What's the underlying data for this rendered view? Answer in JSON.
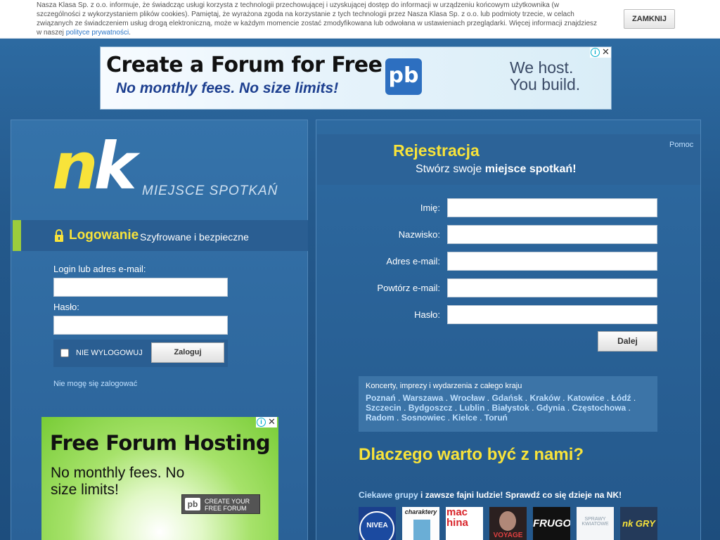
{
  "cookie": {
    "text": "Nasza Klasa Sp. z o.o. informuje, że świadcząc usługi korzysta z technologii przechowującej i uzyskującej dostęp do informacji w urządzeniu końcowym użytkownika (w szczególności z wykorzystaniem plików cookies). Pamiętaj, że wyrażona zgoda na korzystanie z tych technologii przez Nasza Klasa Sp. z o.o. lub podmioty trzecie, w celach związanych ze świadczeniem usług drogą elektroniczną, może w każdym momencie zostać zmodyfikowana lub odwołana w ustawieniach przeglądarki. Więcej informacji znajdziesz w naszej",
    "link": "polityce prywatności",
    "close_label": "ZAMKNIJ"
  },
  "top_ad": {
    "line1": "Create a Forum for Free",
    "line2": "No monthly fees. No size limits!",
    "logo": "pb",
    "right1": "We host.",
    "right2": "You build."
  },
  "left": {
    "logo_n": "n",
    "logo_k": "k",
    "tagline": "MIEJSCE SPOTKAŃ",
    "login_title": "Logowanie",
    "login_sub": "Szyfrowane i bezpieczne",
    "login_label": "Login lub adres e-mail:",
    "password_label": "Hasło:",
    "remember_label": "NIE WYLOGOWUJ",
    "login_button": "Zaloguj",
    "forgot_link": "Nie mogę się zalogować"
  },
  "side_ad": {
    "line1": "Free Forum Hosting",
    "line2": "No monthly fees. No size limits!",
    "cta_logo": "pb",
    "cta": "CREATE YOUR FREE FORUM"
  },
  "right": {
    "title": "Rejestracja",
    "sub_prefix": "Stwórz swoje",
    "sub_bold": "miejsce spotkań!",
    "help": "Pomoc",
    "labels": [
      "Imię:",
      "Nazwisko:",
      "Adres e-mail:",
      "Powtórz e-mail:",
      "Hasło:"
    ],
    "next_button": "Dalej",
    "cities_title": "Koncerty, imprezy i wydarzenia z całego kraju",
    "cities": [
      "Poznań",
      "Warszawa",
      "Wrocław",
      "Gdańsk",
      "Kraków",
      "Katowice",
      "Łódź",
      "Szczecin",
      "Bydgoszcz",
      "Lublin",
      "Białystok",
      "Gdynia",
      "Częstochowa",
      "Radom",
      "Sosnowiec",
      "Kielce",
      "Toruń"
    ],
    "why_title": "Dlaczego warto być z nami?",
    "groups_link": "Ciekawe grupy",
    "groups_rest": " i zawsze fajni ludzie! Sprawdź co się dzieje na NK!",
    "thumbs": [
      "NIVEA",
      "charaktery",
      "machina",
      "VOYAGE",
      "FRUGO",
      "SPRAWY KWIATOWE",
      "nk GRY"
    ]
  },
  "colors": {
    "accent_yellow": "#f8e33a",
    "accent_green": "#9ccc3c",
    "link_blue": "#bfe0ff"
  }
}
